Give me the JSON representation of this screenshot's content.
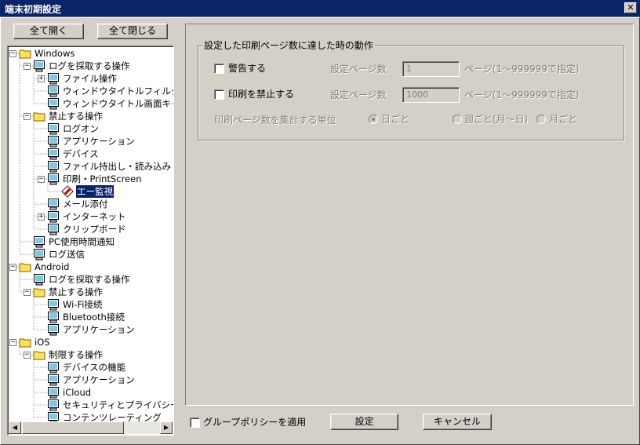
{
  "window": {
    "title": "端末初期設定",
    "close_glyph": "✕"
  },
  "tree_toolbar": {
    "expand_all": "全て開く",
    "collapse_all": "全て閉じる"
  },
  "tree": [
    {
      "label": "Windows",
      "icon": "folder-icon",
      "level": 0,
      "expander": "−"
    },
    {
      "label": "ログを採取する操作",
      "icon": "computer-icon",
      "level": 1,
      "expander": "−"
    },
    {
      "label": "ファイル操作",
      "icon": "computer-icon",
      "level": 2,
      "expander": "+"
    },
    {
      "label": "ウィンドウタイトルフィルタ",
      "icon": "computer-icon",
      "level": 2,
      "expander": ""
    },
    {
      "label": "ウィンドウタイトル画面キャ",
      "icon": "computer-icon",
      "level": 2,
      "expander": ""
    },
    {
      "label": "禁止する操作",
      "icon": "folder-icon",
      "level": 1,
      "expander": "−"
    },
    {
      "label": "ログオン",
      "icon": "computer-icon",
      "level": 2,
      "expander": ""
    },
    {
      "label": "アプリケーション",
      "icon": "computer-icon",
      "level": 2,
      "expander": ""
    },
    {
      "label": "デバイス",
      "icon": "computer-icon",
      "level": 2,
      "expander": ""
    },
    {
      "label": "ファイル持出し・読み込み",
      "icon": "computer-icon",
      "level": 2,
      "expander": ""
    },
    {
      "label": "印刷・PrintScreen",
      "icon": "computer-icon",
      "level": 2,
      "expander": "−"
    },
    {
      "label": "エー監視",
      "icon": "pencil-icon",
      "level": 3,
      "expander": "",
      "selected": true
    },
    {
      "label": "メール添付",
      "icon": "computer-icon",
      "level": 2,
      "expander": ""
    },
    {
      "label": "インターネット",
      "icon": "computer-icon",
      "level": 2,
      "expander": "+"
    },
    {
      "label": "クリップボード",
      "icon": "computer-icon",
      "level": 2,
      "expander": ""
    },
    {
      "label": "PC使用時間通知",
      "icon": "computer-icon",
      "level": 1,
      "expander": ""
    },
    {
      "label": "ログ送信",
      "icon": "computer-icon",
      "level": 1,
      "expander": ""
    },
    {
      "label": "Android",
      "icon": "folder-icon",
      "level": 0,
      "expander": "−"
    },
    {
      "label": "ログを採取する操作",
      "icon": "computer-icon",
      "level": 1,
      "expander": ""
    },
    {
      "label": "禁止する操作",
      "icon": "folder-icon",
      "level": 1,
      "expander": "−"
    },
    {
      "label": "Wi-Fi接続",
      "icon": "computer-icon",
      "level": 2,
      "expander": ""
    },
    {
      "label": "Bluetooth接続",
      "icon": "computer-icon",
      "level": 2,
      "expander": ""
    },
    {
      "label": "アプリケーション",
      "icon": "computer-icon",
      "level": 2,
      "expander": ""
    },
    {
      "label": "iOS",
      "icon": "folder-icon",
      "level": 0,
      "expander": "−"
    },
    {
      "label": "制限する操作",
      "icon": "folder-icon",
      "level": 1,
      "expander": "−"
    },
    {
      "label": "デバイスの機能",
      "icon": "computer-icon",
      "level": 2,
      "expander": ""
    },
    {
      "label": "アプリケーション",
      "icon": "computer-icon",
      "level": 2,
      "expander": ""
    },
    {
      "label": "iCloud",
      "icon": "computer-icon",
      "level": 2,
      "expander": ""
    },
    {
      "label": "セキュリティとプライバシー",
      "icon": "computer-icon",
      "level": 2,
      "expander": ""
    },
    {
      "label": "コンテンツレーティング",
      "icon": "computer-icon",
      "level": 2,
      "expander": ""
    }
  ],
  "scrollbar": {
    "left_arrow": "◀",
    "right_arrow": "▶"
  },
  "print_settings": {
    "group_title": "設定した印刷ページ数に達した時の動作",
    "warn": {
      "label": "警告する",
      "checked": false,
      "pages_label": "設定ページ数",
      "pages_value": "1",
      "hint": "ページ(1〜999999で指定)"
    },
    "block": {
      "label": "印刷を禁止する",
      "checked": false,
      "pages_label": "設定ページ数",
      "pages_value": "1000",
      "hint": "ページ(1〜999999で指定)"
    },
    "unit_label": "印刷ページ数を集計する単位",
    "unit_options": [
      {
        "label": "日ごと",
        "selected": true
      },
      {
        "label": "週ごと(月〜日)",
        "selected": false
      },
      {
        "label": "月ごと",
        "selected": false
      }
    ]
  },
  "footer": {
    "group_policy_label": "グループポリシーを適用",
    "group_policy_checked": false,
    "apply_button": "設定",
    "cancel_button": "キャンセル"
  },
  "colors": {
    "titlebar": "#0a246a",
    "face": "#d4d0c8",
    "selection": "#0a246a",
    "folder": "#ffe25a",
    "monitor_screen": "#7ec8e3"
  }
}
